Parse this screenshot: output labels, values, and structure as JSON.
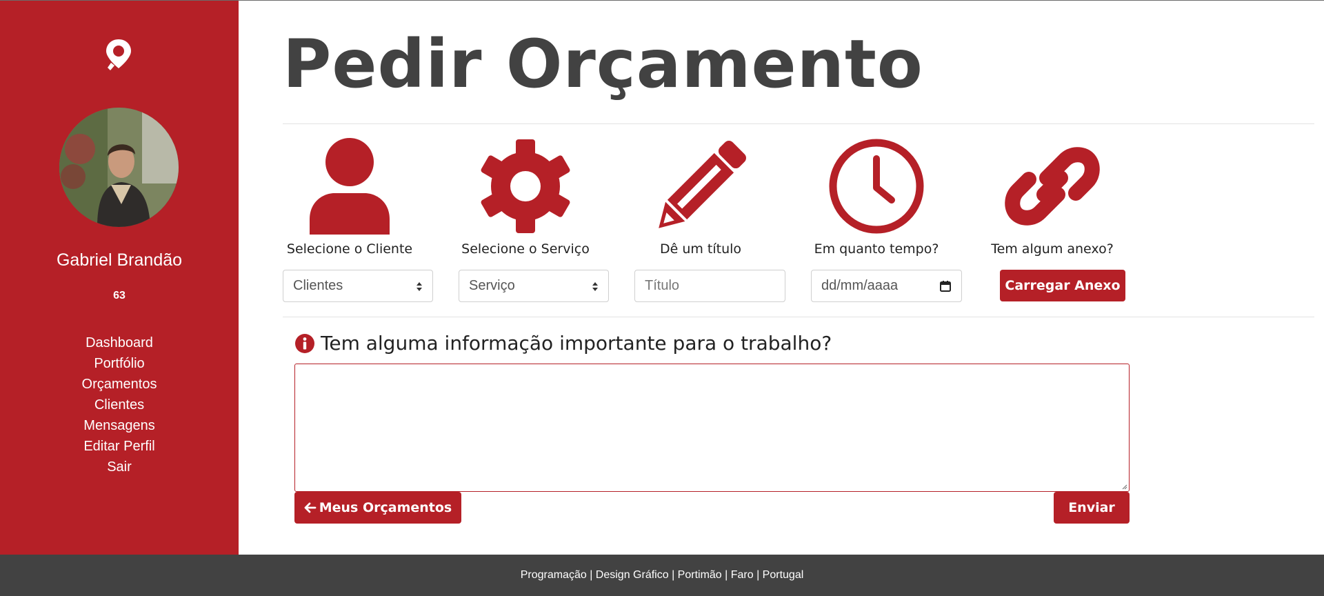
{
  "sidebar": {
    "user_name": "Gabriel Brandão",
    "user_count": "63",
    "nav": [
      "Dashboard",
      "Portfólio",
      "Orçamentos",
      "Clientes",
      "Mensagens",
      "Editar Perfil",
      "Sair"
    ]
  },
  "main": {
    "title": "Pedir Orçamento",
    "steps": [
      {
        "icon": "user-icon",
        "label": "Selecione o Cliente"
      },
      {
        "icon": "gear-icon",
        "label": "Selecione o Serviço"
      },
      {
        "icon": "pencil-icon",
        "label": "Dê um título"
      },
      {
        "icon": "clock-icon",
        "label": "Em quanto tempo?"
      },
      {
        "icon": "link-icon",
        "label": "Tem algum anexo?"
      }
    ],
    "client_select": "Clientes",
    "service_select": "Serviço",
    "title_placeholder": "Título",
    "date_placeholder": "dd/mm/aaaa",
    "upload_button": "Carregar Anexo",
    "info_question": "Tem alguma informação importante para o trabalho?",
    "back_button": "Meus Orçamentos",
    "send_button": "Enviar"
  },
  "footer": {
    "text": "Programação | Design Gráfico | Portimão | Faro | Portugal"
  },
  "colors": {
    "accent": "#b52027",
    "dark": "#424242"
  }
}
